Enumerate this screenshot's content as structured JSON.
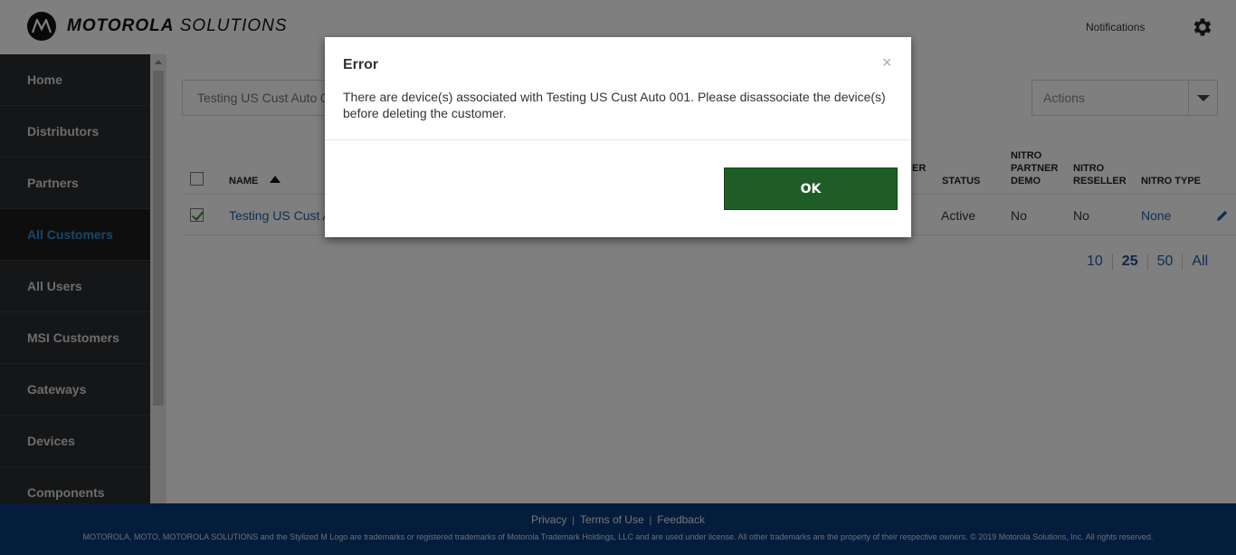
{
  "header": {
    "brand_bold": "MOTOROLA",
    "brand_light": " SOLUTIONS",
    "notifications_label": "Notifications"
  },
  "sidebar": {
    "items": [
      {
        "label": "Home"
      },
      {
        "label": "Distributors"
      },
      {
        "label": "Partners"
      },
      {
        "label": "All Customers",
        "active": true
      },
      {
        "label": "All Users"
      },
      {
        "label": "MSI Customers"
      },
      {
        "label": "Gateways"
      },
      {
        "label": "Devices"
      },
      {
        "label": "Components"
      }
    ]
  },
  "main": {
    "search_value": "Testing US Cust Auto 0",
    "actions_label": "Actions",
    "table": {
      "columns": {
        "name": "NAME",
        "partial": "ER",
        "status": "STATUS",
        "nitro_partner_demo": [
          "NITRO",
          "PARTNER",
          "DEMO"
        ],
        "nitro_reseller": [
          "NITRO",
          "RESELLER"
        ],
        "nitro_type": "NITRO TYPE"
      },
      "rows": [
        {
          "name": "Testing US Cust Auto 001",
          "status": "Active",
          "nitro_partner_demo": "No",
          "nitro_reseller": "No",
          "nitro_type": "None",
          "checked": true
        }
      ]
    },
    "pager": {
      "options": [
        "10",
        "25",
        "50",
        "All"
      ],
      "current": "25"
    }
  },
  "footer": {
    "links": [
      "Privacy",
      "Terms of Use",
      "Feedback"
    ],
    "link_separator": "|",
    "legal": "MOTOROLA, MOTO, MOTOROLA SOLUTIONS and the Stylized M Logo are trademarks or registered trademarks of Motorola Trademark Holdings, LLC and are used under license. All other trademarks are the property of their respective owners. © 2019 Motorola Solutions, Inc. All rights reserved."
  },
  "modal": {
    "title": "Error",
    "close_glyph": "×",
    "body": "There are device(s) associated with Testing US Cust Auto 001. Please disassociate the device(s) before deleting the customer.",
    "ok_label": "OK"
  },
  "colors": {
    "sidebar_bg": "#2b2d30",
    "sidebar_active": "#2d8fd5",
    "footer_bg": "#0b3a78",
    "ok_button": "#1e5e26",
    "link": "#1f5ea8"
  }
}
